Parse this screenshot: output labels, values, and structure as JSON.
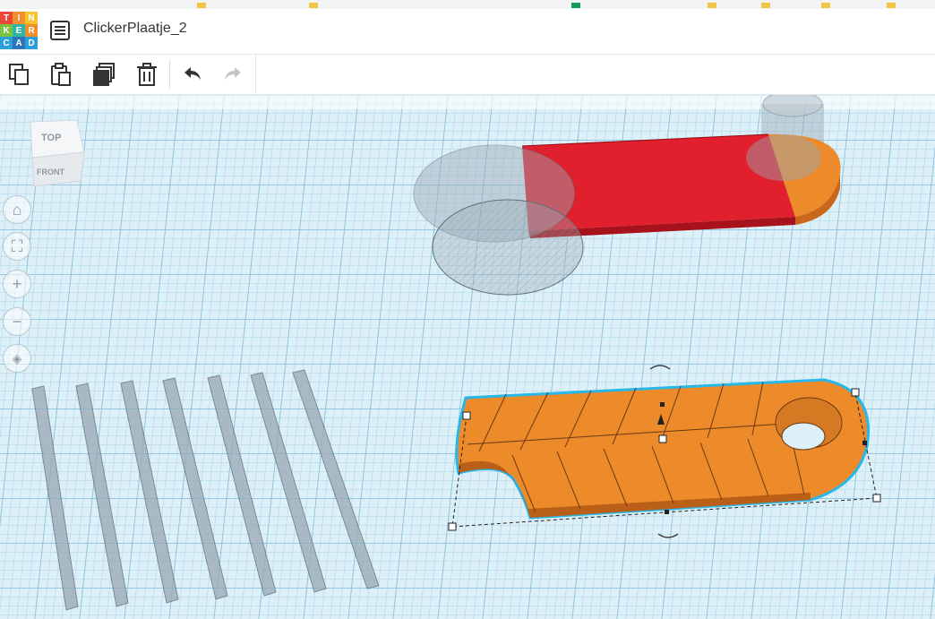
{
  "app": {
    "title": "ClickerPlaatje_2",
    "logo_letters": [
      "T",
      "I",
      "N",
      "K",
      "E",
      "R",
      "C",
      "A",
      "D"
    ]
  },
  "toolbar": [
    {
      "name": "copy",
      "icon": "copy-icon"
    },
    {
      "name": "paste",
      "icon": "paste-icon"
    },
    {
      "name": "duplicate",
      "icon": "duplicate-icon"
    },
    {
      "name": "delete",
      "icon": "trash-icon"
    },
    {
      "name": "undo",
      "icon": "undo-icon"
    },
    {
      "name": "redo",
      "icon": "redo-icon"
    }
  ],
  "viewcube": {
    "top_label": "TOP",
    "front_label": "FRONT"
  },
  "nav_controls": [
    "home-icon",
    "fit-icon",
    "zoom-in-icon",
    "zoom-out-icon",
    "perspective-icon"
  ],
  "colors": {
    "grid_bg": "#ddf0f8",
    "grid_line": "#a7d3e6",
    "grid_major": "#7dbcd9",
    "red_shape": "#e21f2c",
    "orange_shape": "#ed8a2a",
    "hole_gray": "#9aa9b4",
    "selection": "#29b6e8"
  }
}
